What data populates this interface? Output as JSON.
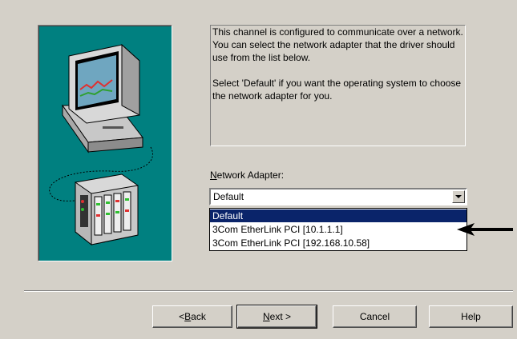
{
  "description": {
    "paragraph1": "This channel is configured to communicate over a network.  You can select the network adapter that the driver should use from the list below.",
    "paragraph2": "Select 'Default' if you want the operating system to choose the network adapter for you."
  },
  "network_adapter": {
    "label_prefix": "",
    "label_accel": "N",
    "label_rest": "etwork Adapter:",
    "selected_value": "Default",
    "options": [
      "Default",
      "3Com EtherLink PCI [10.1.1.1]",
      "3Com EtherLink PCI [192.168.10.58]"
    ],
    "highlighted_index": 0
  },
  "buttons": {
    "back": {
      "prefix": "< ",
      "accel": "B",
      "rest": "ack"
    },
    "next": {
      "prefix": "",
      "accel": "N",
      "rest": "ext >"
    },
    "cancel": "Cancel",
    "help": "Help"
  },
  "icons": {
    "illustration": "computer-network-device-illustration",
    "pointer": "arrow-left-icon",
    "dropdown": "chevron-down-icon"
  },
  "colors": {
    "panel": "#008080",
    "dialog": "#d4d0c8",
    "selection": "#0a246a"
  }
}
